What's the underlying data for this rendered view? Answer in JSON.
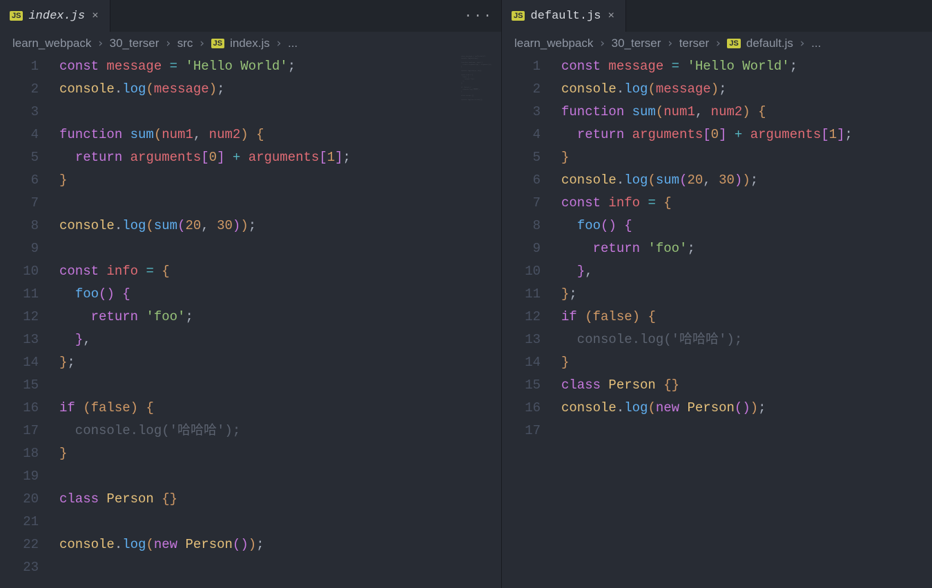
{
  "left": {
    "tab": {
      "badge": "JS",
      "label": "index.js",
      "close": "×"
    },
    "actions": "···",
    "breadcrumbs": [
      "learn_webpack",
      "30_terser",
      "src",
      {
        "badge": "JS",
        "label": "index.js"
      },
      "..."
    ],
    "lines": [
      [
        [
          "c-kw",
          "const"
        ],
        [
          "c-pun",
          " "
        ],
        [
          "c-varr",
          "message"
        ],
        [
          "c-pun",
          " "
        ],
        [
          "c-op",
          "="
        ],
        [
          "c-pun",
          " "
        ],
        [
          "c-str",
          "'Hello World'"
        ],
        [
          "c-pun",
          ";"
        ]
      ],
      [
        [
          "c-var",
          "console"
        ],
        [
          "c-pun",
          "."
        ],
        [
          "c-fn",
          "log"
        ],
        [
          "c-brk1",
          "("
        ],
        [
          "c-varr",
          "message"
        ],
        [
          "c-brk1",
          ")"
        ],
        [
          "c-pun",
          ";"
        ]
      ],
      [],
      [
        [
          "c-kw",
          "function"
        ],
        [
          "c-pun",
          " "
        ],
        [
          "c-fn",
          "sum"
        ],
        [
          "c-brk1",
          "("
        ],
        [
          "c-varr",
          "num1"
        ],
        [
          "c-pun",
          ", "
        ],
        [
          "c-varr",
          "num2"
        ],
        [
          "c-brk1",
          ")"
        ],
        [
          "c-pun",
          " "
        ],
        [
          "c-brk1",
          "{"
        ]
      ],
      [
        [
          "c-pun",
          "  "
        ],
        [
          "c-kw",
          "return"
        ],
        [
          "c-pun",
          " "
        ],
        [
          "c-varr",
          "arguments"
        ],
        [
          "c-brk2",
          "["
        ],
        [
          "c-num",
          "0"
        ],
        [
          "c-brk2",
          "]"
        ],
        [
          "c-pun",
          " "
        ],
        [
          "c-op",
          "+"
        ],
        [
          "c-pun",
          " "
        ],
        [
          "c-varr",
          "arguments"
        ],
        [
          "c-brk2",
          "["
        ],
        [
          "c-num",
          "1"
        ],
        [
          "c-brk2",
          "]"
        ],
        [
          "c-pun",
          ";"
        ]
      ],
      [
        [
          "c-brk1",
          "}"
        ]
      ],
      [],
      [
        [
          "c-var",
          "console"
        ],
        [
          "c-pun",
          "."
        ],
        [
          "c-fn",
          "log"
        ],
        [
          "c-brk1",
          "("
        ],
        [
          "c-fn",
          "sum"
        ],
        [
          "c-brk2",
          "("
        ],
        [
          "c-num",
          "20"
        ],
        [
          "c-pun",
          ", "
        ],
        [
          "c-num",
          "30"
        ],
        [
          "c-brk2",
          ")"
        ],
        [
          "c-brk1",
          ")"
        ],
        [
          "c-pun",
          ";"
        ]
      ],
      [],
      [
        [
          "c-kw",
          "const"
        ],
        [
          "c-pun",
          " "
        ],
        [
          "c-varr",
          "info"
        ],
        [
          "c-pun",
          " "
        ],
        [
          "c-op",
          "="
        ],
        [
          "c-pun",
          " "
        ],
        [
          "c-brk1",
          "{"
        ]
      ],
      [
        [
          "c-pun",
          "  "
        ],
        [
          "c-fn",
          "foo"
        ],
        [
          "c-brk2",
          "("
        ],
        [
          "c-brk2",
          ")"
        ],
        [
          "c-pun",
          " "
        ],
        [
          "c-brk2",
          "{"
        ]
      ],
      [
        [
          "c-pun",
          "    "
        ],
        [
          "c-kw",
          "return"
        ],
        [
          "c-pun",
          " "
        ],
        [
          "c-str",
          "'foo'"
        ],
        [
          "c-pun",
          ";"
        ]
      ],
      [
        [
          "c-pun",
          "  "
        ],
        [
          "c-brk2",
          "}"
        ],
        [
          "c-pun",
          ","
        ]
      ],
      [
        [
          "c-brk1",
          "}"
        ],
        [
          "c-pun",
          ";"
        ]
      ],
      [],
      [
        [
          "c-kw",
          "if"
        ],
        [
          "c-pun",
          " "
        ],
        [
          "c-brk1",
          "("
        ],
        [
          "c-bool",
          "false"
        ],
        [
          "c-brk1",
          ")"
        ],
        [
          "c-pun",
          " "
        ],
        [
          "c-brk1",
          "{"
        ]
      ],
      [
        [
          "c-dim",
          "  console.log('哈哈哈');"
        ]
      ],
      [
        [
          "c-brk1",
          "}"
        ]
      ],
      [],
      [
        [
          "c-kw",
          "class"
        ],
        [
          "c-pun",
          " "
        ],
        [
          "c-var",
          "Person"
        ],
        [
          "c-pun",
          " "
        ],
        [
          "c-brk1",
          "{"
        ],
        [
          "c-brk1",
          "}"
        ]
      ],
      [],
      [
        [
          "c-var",
          "console"
        ],
        [
          "c-pun",
          "."
        ],
        [
          "c-fn",
          "log"
        ],
        [
          "c-brk1",
          "("
        ],
        [
          "c-kw",
          "new"
        ],
        [
          "c-pun",
          " "
        ],
        [
          "c-var",
          "Person"
        ],
        [
          "c-brk2",
          "("
        ],
        [
          "c-brk2",
          ")"
        ],
        [
          "c-brk1",
          ")"
        ],
        [
          "c-pun",
          ";"
        ]
      ],
      []
    ]
  },
  "right": {
    "tab": {
      "badge": "JS",
      "label": "default.js",
      "close": "×"
    },
    "breadcrumbs": [
      "learn_webpack",
      "30_terser",
      "terser",
      {
        "badge": "JS",
        "label": "default.js"
      },
      "..."
    ],
    "lines": [
      [
        [
          "c-kw",
          "const"
        ],
        [
          "c-pun",
          " "
        ],
        [
          "c-varr",
          "message"
        ],
        [
          "c-pun",
          " "
        ],
        [
          "c-op",
          "="
        ],
        [
          "c-pun",
          " "
        ],
        [
          "c-str",
          "'Hello World'"
        ],
        [
          "c-pun",
          ";"
        ]
      ],
      [
        [
          "c-var",
          "console"
        ],
        [
          "c-pun",
          "."
        ],
        [
          "c-fn",
          "log"
        ],
        [
          "c-brk1",
          "("
        ],
        [
          "c-varr",
          "message"
        ],
        [
          "c-brk1",
          ")"
        ],
        [
          "c-pun",
          ";"
        ]
      ],
      [
        [
          "c-kw",
          "function"
        ],
        [
          "c-pun",
          " "
        ],
        [
          "c-fn",
          "sum"
        ],
        [
          "c-brk1",
          "("
        ],
        [
          "c-varr",
          "num1"
        ],
        [
          "c-pun",
          ", "
        ],
        [
          "c-varr",
          "num2"
        ],
        [
          "c-brk1",
          ")"
        ],
        [
          "c-pun",
          " "
        ],
        [
          "c-brk1",
          "{"
        ]
      ],
      [
        [
          "c-pun",
          "  "
        ],
        [
          "c-kw",
          "return"
        ],
        [
          "c-pun",
          " "
        ],
        [
          "c-varr",
          "arguments"
        ],
        [
          "c-brk2",
          "["
        ],
        [
          "c-num",
          "0"
        ],
        [
          "c-brk2",
          "]"
        ],
        [
          "c-pun",
          " "
        ],
        [
          "c-op",
          "+"
        ],
        [
          "c-pun",
          " "
        ],
        [
          "c-varr",
          "arguments"
        ],
        [
          "c-brk2",
          "["
        ],
        [
          "c-num",
          "1"
        ],
        [
          "c-brk2",
          "]"
        ],
        [
          "c-pun",
          ";"
        ]
      ],
      [
        [
          "c-brk1",
          "}"
        ]
      ],
      [
        [
          "c-var",
          "console"
        ],
        [
          "c-pun",
          "."
        ],
        [
          "c-fn",
          "log"
        ],
        [
          "c-brk1",
          "("
        ],
        [
          "c-fn",
          "sum"
        ],
        [
          "c-brk2",
          "("
        ],
        [
          "c-num",
          "20"
        ],
        [
          "c-pun",
          ", "
        ],
        [
          "c-num",
          "30"
        ],
        [
          "c-brk2",
          ")"
        ],
        [
          "c-brk1",
          ")"
        ],
        [
          "c-pun",
          ";"
        ]
      ],
      [
        [
          "c-kw",
          "const"
        ],
        [
          "c-pun",
          " "
        ],
        [
          "c-varr",
          "info"
        ],
        [
          "c-pun",
          " "
        ],
        [
          "c-op",
          "="
        ],
        [
          "c-pun",
          " "
        ],
        [
          "c-brk1",
          "{"
        ]
      ],
      [
        [
          "c-pun",
          "  "
        ],
        [
          "c-fn",
          "foo"
        ],
        [
          "c-brk2",
          "("
        ],
        [
          "c-brk2",
          ")"
        ],
        [
          "c-pun",
          " "
        ],
        [
          "c-brk2",
          "{"
        ]
      ],
      [
        [
          "c-pun",
          "    "
        ],
        [
          "c-kw",
          "return"
        ],
        [
          "c-pun",
          " "
        ],
        [
          "c-str",
          "'foo'"
        ],
        [
          "c-pun",
          ";"
        ]
      ],
      [
        [
          "c-pun",
          "  "
        ],
        [
          "c-brk2",
          "}"
        ],
        [
          "c-pun",
          ","
        ]
      ],
      [
        [
          "c-brk1",
          "}"
        ],
        [
          "c-pun",
          ";"
        ]
      ],
      [
        [
          "c-kw",
          "if"
        ],
        [
          "c-pun",
          " "
        ],
        [
          "c-brk1",
          "("
        ],
        [
          "c-bool",
          "false"
        ],
        [
          "c-brk1",
          ")"
        ],
        [
          "c-pun",
          " "
        ],
        [
          "c-brk1",
          "{"
        ]
      ],
      [
        [
          "c-dim",
          "  console.log('哈哈哈');"
        ]
      ],
      [
        [
          "c-brk1",
          "}"
        ]
      ],
      [
        [
          "c-kw",
          "class"
        ],
        [
          "c-pun",
          " "
        ],
        [
          "c-var",
          "Person"
        ],
        [
          "c-pun",
          " "
        ],
        [
          "c-brk1",
          "{"
        ],
        [
          "c-brk1",
          "}"
        ]
      ],
      [
        [
          "c-var",
          "console"
        ],
        [
          "c-pun",
          "."
        ],
        [
          "c-fn",
          "log"
        ],
        [
          "c-brk1",
          "("
        ],
        [
          "c-kw",
          "new"
        ],
        [
          "c-pun",
          " "
        ],
        [
          "c-var",
          "Person"
        ],
        [
          "c-brk2",
          "("
        ],
        [
          "c-brk2",
          ")"
        ],
        [
          "c-brk1",
          ")"
        ],
        [
          "c-pun",
          ";"
        ]
      ],
      []
    ]
  }
}
